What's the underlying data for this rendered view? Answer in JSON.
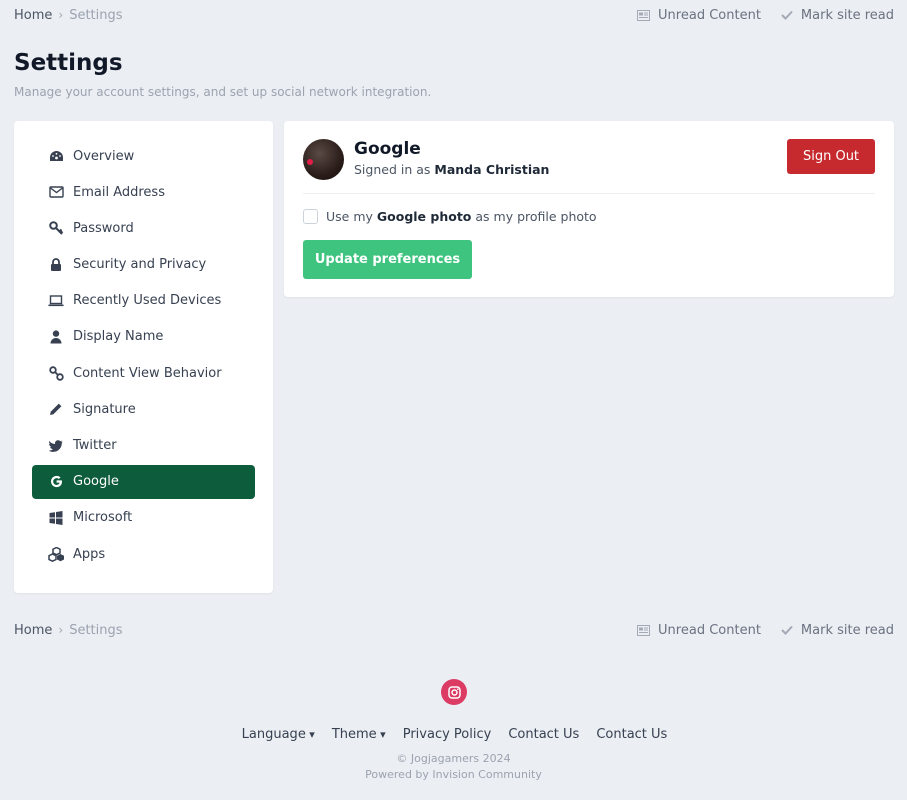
{
  "breadcrumb": {
    "home": "Home",
    "separator": "›",
    "current": "Settings",
    "unread_content": "Unread Content",
    "mark_site_read": "Mark site read"
  },
  "page": {
    "title": "Settings",
    "subtitle": "Manage your account settings, and set up social network integration."
  },
  "sidebar": {
    "items": [
      {
        "label": "Overview",
        "icon": "dashboard-icon"
      },
      {
        "label": "Email Address",
        "icon": "envelope-icon"
      },
      {
        "label": "Password",
        "icon": "key-icon"
      },
      {
        "label": "Security and Privacy",
        "icon": "lock-icon"
      },
      {
        "label": "Recently Used Devices",
        "icon": "laptop-icon"
      },
      {
        "label": "Display Name",
        "icon": "user-icon"
      },
      {
        "label": "Content View Behavior",
        "icon": "link-icon"
      },
      {
        "label": "Signature",
        "icon": "pencil-icon"
      },
      {
        "label": "Twitter",
        "icon": "twitter-icon"
      },
      {
        "label": "Google",
        "icon": "google-icon",
        "active": true
      },
      {
        "label": "Microsoft",
        "icon": "windows-icon"
      },
      {
        "label": "Apps",
        "icon": "cubes-icon"
      }
    ]
  },
  "panel": {
    "provider_name": "Google",
    "signed_in_prefix": "Signed in as",
    "user_name": "Manda Christian",
    "sign_out_label": "Sign Out",
    "checkbox_prefix": "Use my",
    "checkbox_bold": "Google photo",
    "checkbox_suffix": "as my profile photo",
    "checkbox_checked": false,
    "update_label": "Update preferences"
  },
  "footer": {
    "language": "Language",
    "theme": "Theme",
    "privacy": "Privacy Policy",
    "contact1": "Contact Us",
    "contact2": "Contact Us",
    "copyright": "© Jogjagamers 2024",
    "powered": "Powered by Invision Community"
  },
  "colors": {
    "active": "#0d5c3b",
    "sign_out": "#c62a2f",
    "update": "#3ec47f",
    "instagram": "#dc3b63"
  }
}
